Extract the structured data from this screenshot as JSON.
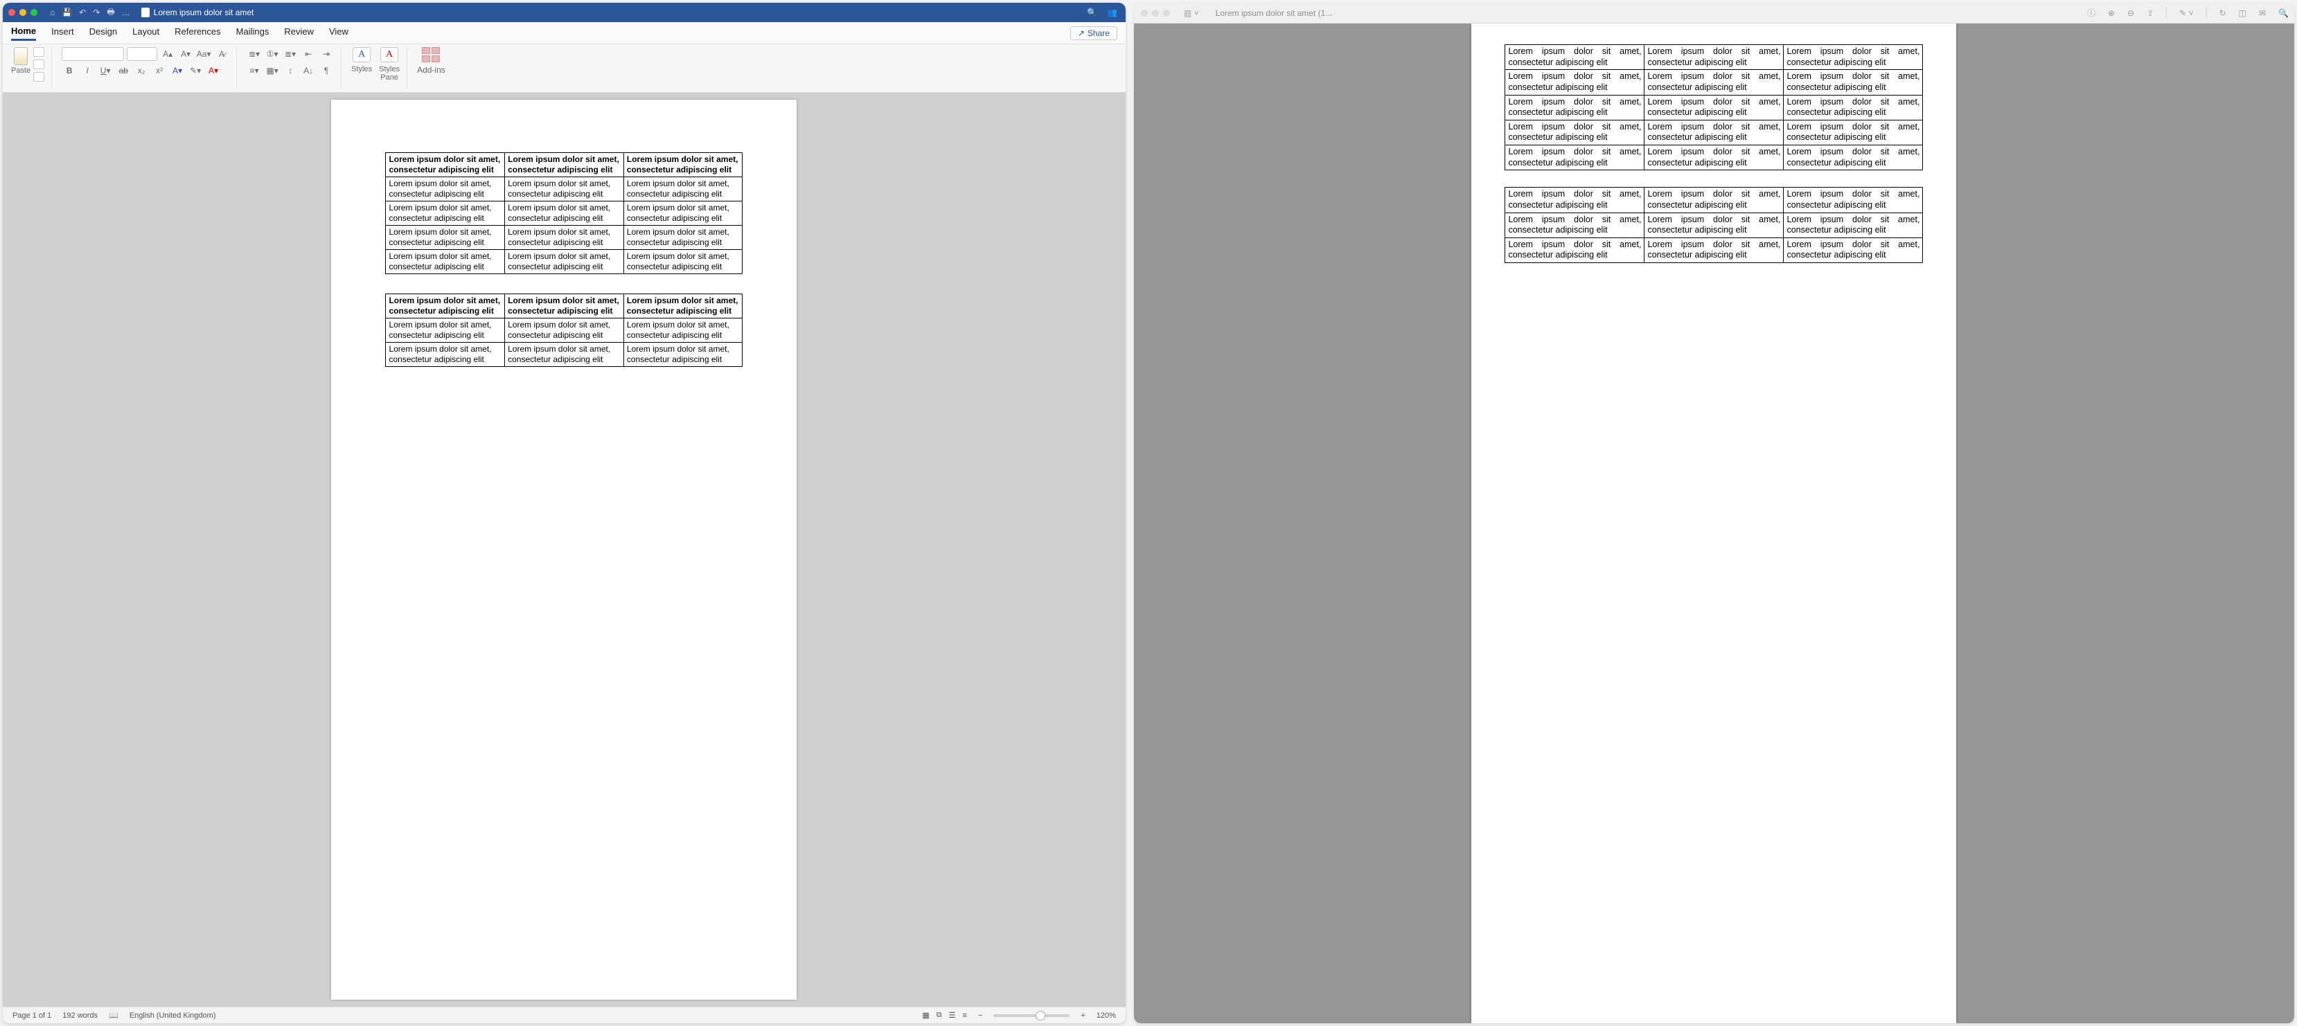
{
  "word": {
    "title": "Lorem ipsum dolor sit amet",
    "tabs": [
      "Home",
      "Insert",
      "Design",
      "Layout",
      "References",
      "Mailings",
      "Review",
      "View"
    ],
    "active_tab": 0,
    "share": "Share",
    "paste": "Paste",
    "styles": "Styles",
    "styles_pane": "Styles\nPane",
    "addins": "Add-ins",
    "status": {
      "page": "Page 1 of 1",
      "words": "192 words",
      "lang": "English (United Kingdom)",
      "zoom": "120%"
    },
    "tables": [
      {
        "rows": 5,
        "cols": 3,
        "header": "Lorem ipsum dolor sit amet, consectetur adipiscing elit",
        "body": "Lorem ipsum dolor sit amet, consectetur adipiscing elit"
      },
      {
        "rows": 3,
        "cols": 3,
        "header": "Lorem ipsum dolor sit amet, consectetur adipiscing elit",
        "body": "Lorem ipsum dolor sit amet, consectetur adipiscing elit"
      }
    ]
  },
  "preview": {
    "title": "Lorem ipsum dolor sit amet (1...",
    "tables": [
      {
        "rows": 5,
        "cols": 3,
        "header": "Lorem ipsum dolor sit amet, consectetur adipiscing elit",
        "body": "Lorem ipsum dolor sit amet, consectetur adipiscing elit"
      },
      {
        "rows": 3,
        "cols": 3,
        "header": "Lorem ipsum dolor sit amet, consectetur adipiscing elit",
        "body": "Lorem ipsum dolor sit amet, consectetur adipiscing elit"
      }
    ]
  }
}
